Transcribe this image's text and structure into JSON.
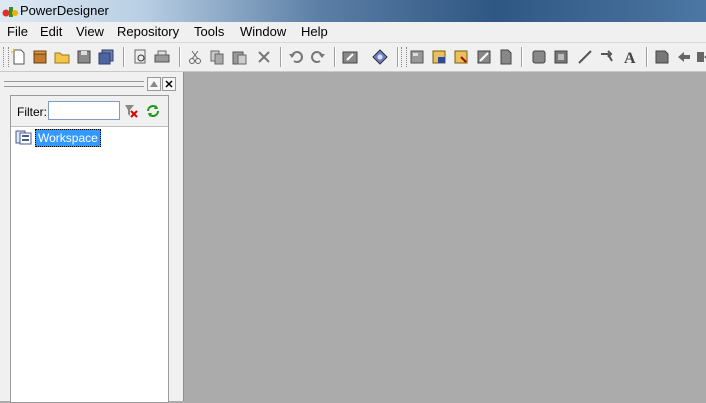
{
  "window": {
    "title": "PowerDesigner"
  },
  "menu": [
    {
      "label": "File"
    },
    {
      "label": "Edit"
    },
    {
      "label": "View"
    },
    {
      "label": "Repository"
    },
    {
      "label": "Tools"
    },
    {
      "label": "Window"
    },
    {
      "label": "Help"
    }
  ],
  "toolbar": {
    "icons": [
      "new-icon",
      "open-package-icon",
      "open-folder-icon",
      "save-icon",
      "save-all-icon",
      "print-preview-icon",
      "print-icon",
      "cut-icon",
      "copy-icon",
      "paste-icon",
      "delete-icon",
      "undo-icon",
      "redo-icon",
      "model-properties-icon",
      "check-model-icon",
      "select-icon",
      "repository-checkin-icon",
      "repository-checkout-icon",
      "image-icon",
      "document-icon",
      "shape-icon",
      "picture-icon",
      "line-icon",
      "link-icon",
      "text-icon",
      "note-icon",
      "arrow-icon",
      "more-arrow-icon"
    ]
  },
  "browser": {
    "filter_label": "Filter:",
    "filter_value": "",
    "tree": [
      {
        "label": "Workspace",
        "selected": true
      }
    ]
  },
  "colors": {
    "selection": "#3399ff",
    "workspace_bg": "#ababab",
    "chrome": "#f0f0f0"
  }
}
